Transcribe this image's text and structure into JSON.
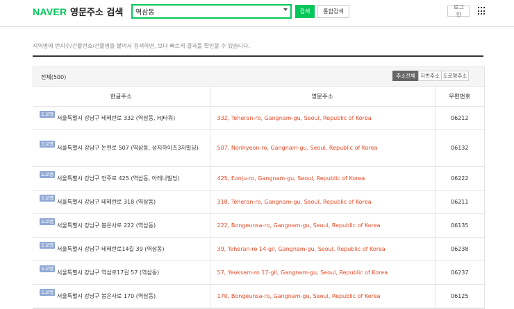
{
  "header": {
    "logo": "NAVER",
    "service_title": "영문주소 검색",
    "search": {
      "value": "역삼동",
      "placeholder": ""
    },
    "search_button": "검색",
    "integrated_search_button": "통합검색",
    "login_button": "로그인",
    "apps_icon": "grid-icon"
  },
  "notice": "지역명에 번지수/건물번호/건물명을 붙여서 검색하면, 보다 빠르게 결과를 확인할 수 있습니다.",
  "results": {
    "total_label": "전체(500)",
    "filters": [
      {
        "label": "주소전체",
        "active": true
      },
      {
        "label": "지번주소",
        "active": false
      },
      {
        "label": "도로명주소",
        "active": false
      }
    ],
    "columns": [
      "한글주소",
      "영문주소",
      "우편번호"
    ],
    "rows": [
      {
        "badge": "도로명",
        "kr": "서울특별시 강남구 테헤란로 332 (역삼동, HJ타워)",
        "en": "332, Teheran-ro, Gangnam-gu, Seoul, Republic of Korea",
        "zip": "06212"
      },
      {
        "badge": "도로명",
        "kr": "서울특별시 강남구 논현로 507 (역삼동, 성지하이츠3차빌딩)",
        "en": "507, Nonhyeon-ro, Gangnam-gu, Seoul, Republic of Korea",
        "zip": "06132"
      },
      {
        "badge": "도로명",
        "kr": "서울특별시 강남구 언주로 425 (역삼동, 아레나빌딩)",
        "en": "425, Eonju-ro, Gangnam-gu, Seoul, Republic of Korea",
        "zip": "06222"
      },
      {
        "badge": "도로명",
        "kr": "서울특별시 강남구 테헤란로 318 (역삼동)",
        "en": "318, Teheran-ro, Gangnam-gu, Seoul, Republic of Korea",
        "zip": "06211"
      },
      {
        "badge": "도로명",
        "kr": "서울특별시 강남구 봉은사로 222 (역삼동)",
        "en": "222, Bongeunsa-ro, Gangnam-gu, Seoul, Republic of Korea",
        "zip": "06135"
      },
      {
        "badge": "도로명",
        "kr": "서울특별시 강남구 테헤란로14길 39 (역삼동)",
        "en": "39, Teheran-ro 14-gil, Gangnam-gu, Seoul, Republic of Korea",
        "zip": "06238"
      },
      {
        "badge": "도로명",
        "kr": "서울특별시 강남구 역삼로17길 57 (역삼동)",
        "en": "57, Yeoksam-ro 17-gil, Gangnam-gu, Seoul, Republic of Korea",
        "zip": "06237"
      },
      {
        "badge": "도로명",
        "kr": "서울특별시 강남구 봉은사로 170 (역삼동)",
        "en": "170, Bongeunsa-ro, Gangnam-gu, Seoul, Republic of Korea",
        "zip": "06125"
      }
    ]
  },
  "colors": {
    "brand": "#03c75a",
    "english_address": "#e54825",
    "badge": "#8fa9d6"
  }
}
